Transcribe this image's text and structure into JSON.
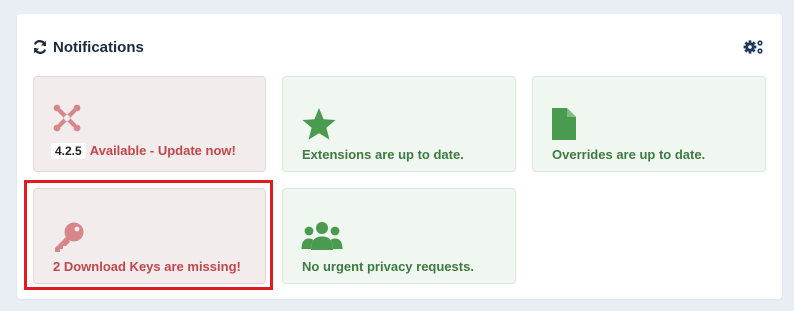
{
  "panel": {
    "title": "Notifications",
    "refresh_icon": "refresh-icon",
    "settings_icon": "cogs-icon"
  },
  "tiles": {
    "joomla_update": {
      "version": "4.2.5",
      "label": "Available - Update now!",
      "icon": "joomla-icon",
      "status": "warning"
    },
    "extensions": {
      "label": "Extensions are up to date.",
      "icon": "star-icon",
      "status": "ok"
    },
    "overrides": {
      "label": "Overrides are up to date.",
      "icon": "file-icon",
      "status": "ok"
    },
    "download_keys": {
      "label": "2 Download Keys are missing!",
      "icon": "key-icon",
      "status": "warning"
    },
    "privacy": {
      "label": "No urgent privacy requests.",
      "icon": "users-icon",
      "status": "ok"
    }
  },
  "colors": {
    "warning_text": "#c1464c",
    "ok_text": "#3f7a42",
    "warning_icon": "#d7868a",
    "ok_icon": "#4a9b4f",
    "highlight": "#e01b22"
  }
}
